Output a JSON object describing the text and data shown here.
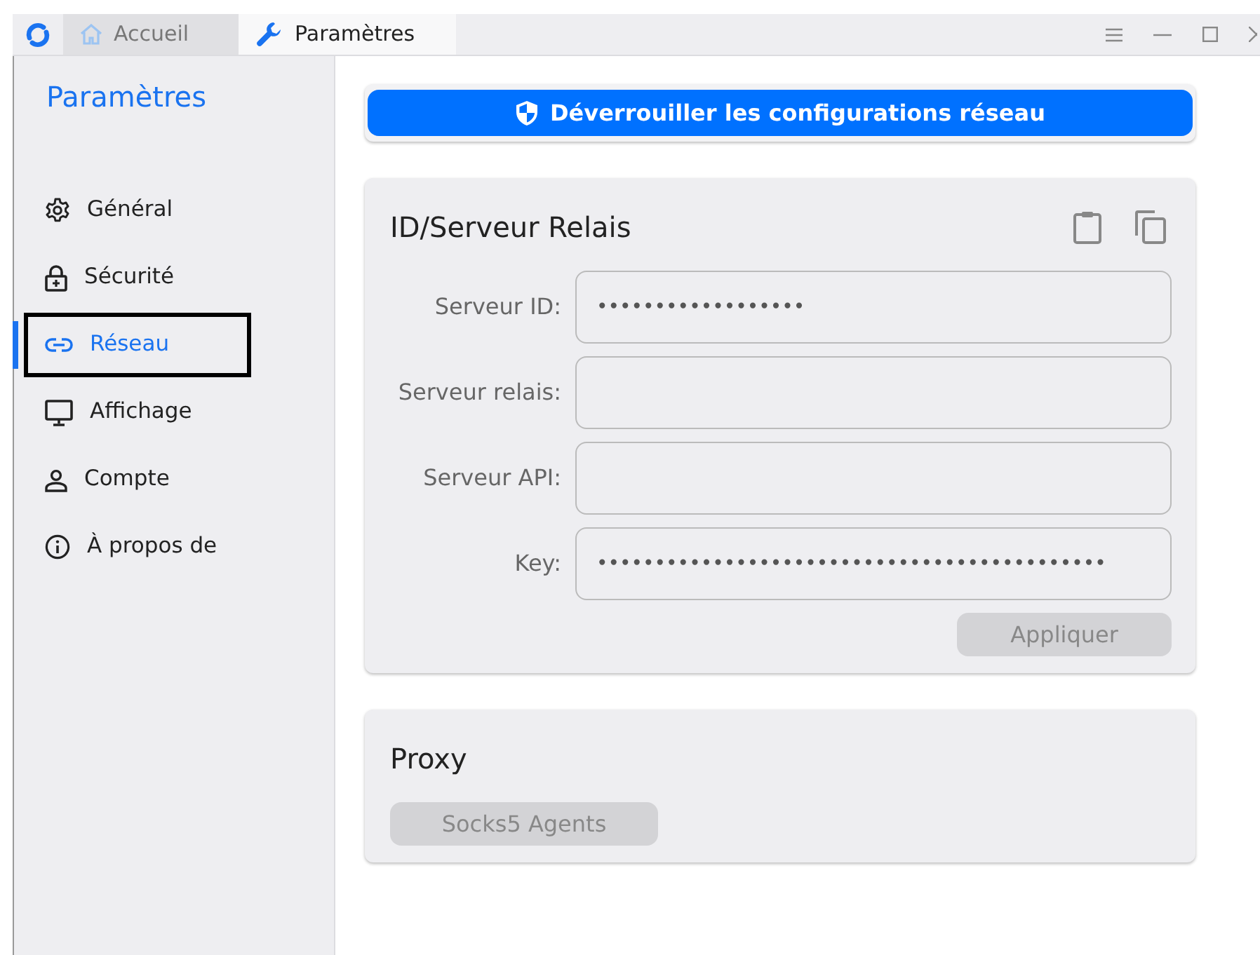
{
  "tabs": [
    {
      "label": "Accueil",
      "selected": false
    },
    {
      "label": "Paramètres",
      "selected": true
    }
  ],
  "sidebar": {
    "title": "Paramètres",
    "items": [
      {
        "label": "Général",
        "selected": false,
        "outlined": false
      },
      {
        "label": "Sécurité",
        "selected": false,
        "outlined": false
      },
      {
        "label": "Réseau",
        "selected": true,
        "outlined": true
      },
      {
        "label": "Affichage",
        "selected": false,
        "outlined": false
      },
      {
        "label": "Compte",
        "selected": false,
        "outlined": false
      },
      {
        "label": "À propos de",
        "selected": false,
        "outlined": false
      }
    ]
  },
  "unlock_button": {
    "label": "Déverrouiller les configurations réseau"
  },
  "server_card": {
    "title": "ID/Serveur Relais",
    "fields": [
      {
        "label": "Serveur ID:",
        "value": "••••••••••••••••••"
      },
      {
        "label": "Serveur relais:"
      },
      {
        "label": "Serveur API:"
      },
      {
        "label": "Key:",
        "value": "••••••••••••••••••••••••••••••••••••••••••••"
      }
    ],
    "apply_button": {
      "label": "Appliquer",
      "disabled": true
    }
  },
  "proxy_card": {
    "title": "Proxy",
    "button": {
      "label": "Socks5 Agents",
      "disabled": true
    }
  }
}
